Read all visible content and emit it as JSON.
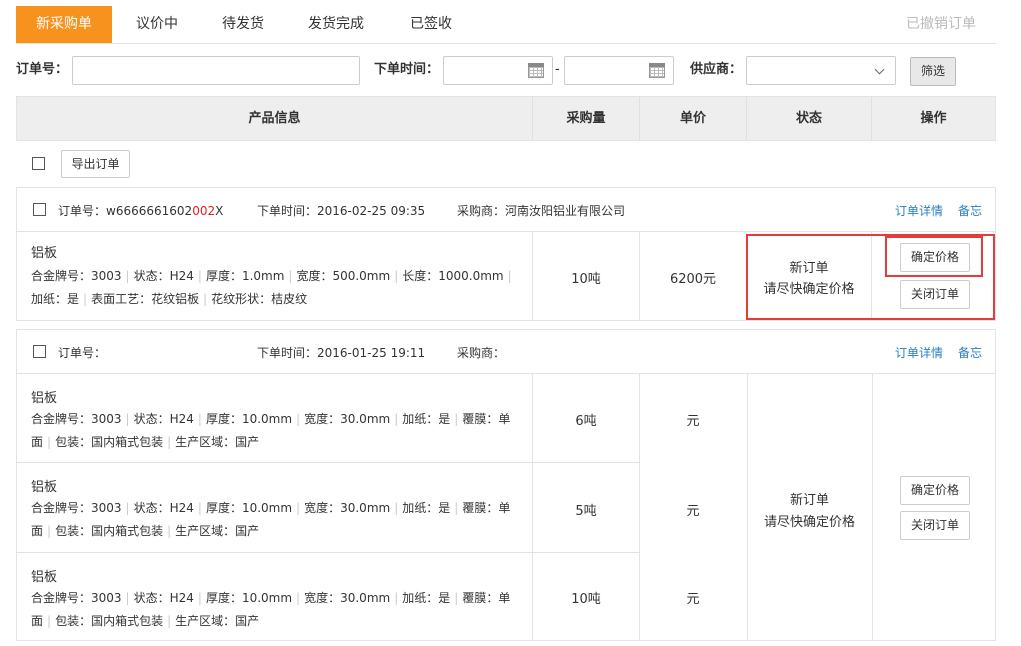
{
  "tabs": [
    {
      "label": "新采购单"
    },
    {
      "label": "议价中"
    },
    {
      "label": "待发货"
    },
    {
      "label": "发货完成"
    },
    {
      "label": "已签收"
    }
  ],
  "tab_right": "已撤销订单",
  "accent_color": "#f7921e",
  "filters": {
    "order_no_label": "订单号：",
    "order_time_label": "下单时间：",
    "date_sep": "-",
    "supplier_label": "供应商：",
    "filter_button": "筛选"
  },
  "columns": [
    "产品信息",
    "采购量",
    "单价",
    "状态",
    "操作"
  ],
  "export_button": "导出订单",
  "labels": {
    "order_no": "订单号：",
    "order_time": "下单时间：",
    "buyer": "采购商：",
    "detail": "订单详情",
    "memo": "备忘"
  },
  "orders": [
    {
      "no_prefix": "w6666661602",
      "no_highlight": "002",
      "no_suffix": "X",
      "time": "2016-02-25 09:35",
      "buyer": "河南汝阳铝业有限公司",
      "items": [
        {
          "title": "铝板",
          "line1": [
            "合金牌号：3003",
            "状态：H24",
            "厚度：1.0mm",
            "宽度：500.0mm",
            "长度：1000.0mm"
          ],
          "line2": [
            "加纸：是",
            "表面工艺：花纹铝板",
            "花纹形状：桔皮纹"
          ],
          "qty": "10吨",
          "price": "6200元"
        }
      ],
      "status1": "新订单",
      "status2": "请尽快确定价格",
      "actions": [
        "确定价格",
        "关闭订单"
      ]
    },
    {
      "no_prefix": "",
      "time": "2016-01-25 19:11",
      "buyer": "",
      "items": [
        {
          "title": "铝板",
          "line1": [
            "合金牌号：3003",
            "状态：H24",
            "厚度：10.0mm",
            "宽度：30.0mm",
            "加纸：是",
            "覆膜：单"
          ],
          "line2": [
            "面",
            "包装：国内箱式包装",
            "生产区域：国产"
          ],
          "qty": "6吨",
          "price": "元"
        },
        {
          "title": "铝板",
          "line1": [
            "合金牌号：3003",
            "状态：H24",
            "厚度：10.0mm",
            "宽度：30.0mm",
            "加纸：是",
            "覆膜：单"
          ],
          "line2": [
            "面",
            "包装：国内箱式包装",
            "生产区域：国产"
          ],
          "qty": "5吨",
          "price": "元"
        },
        {
          "title": "铝板",
          "line1": [
            "合金牌号：3003",
            "状态：H24",
            "厚度：10.0mm",
            "宽度：30.0mm",
            "加纸：是",
            "覆膜：单"
          ],
          "line2": [
            "面",
            "包装：国内箱式包装",
            "生产区域：国产"
          ],
          "qty": "10吨",
          "price": "元"
        }
      ],
      "status1": "新订单",
      "status2": "请尽快确定价格",
      "actions": [
        "确定价格",
        "关闭订单"
      ]
    }
  ]
}
